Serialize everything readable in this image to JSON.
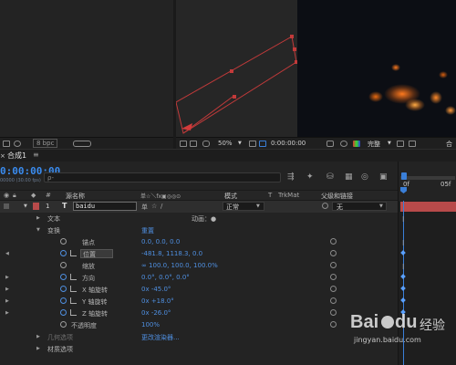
{
  "viewer": {
    "zoom": "50%",
    "timecode": "0:00:00:00",
    "resolution": "完整"
  },
  "project": {
    "bpc": "8 bpc"
  },
  "timeline": {
    "comp_tab": "合成1",
    "timecode": "0:00:00:00",
    "fps": "00000 (30.00 fps)",
    "search_placeholder": "ρ-",
    "columns": {
      "index": "#",
      "layer_name": "源名称",
      "switches": "单☆＼fx▣◎◎⊙",
      "mode": "模式",
      "t": "T",
      "trkmat": "TrkMat",
      "parent": "父级和链接"
    },
    "ruler_labels": [
      "0f",
      "05f"
    ],
    "layer": {
      "index": "1",
      "type": "T",
      "name": "baidu",
      "mode": "正常",
      "parent": "无"
    },
    "rows": [
      {
        "kind": "group",
        "label": "文本",
        "value": "",
        "extra": "动画：●"
      },
      {
        "kind": "group",
        "label": "变换",
        "value": "重置",
        "extra": ""
      },
      {
        "kind": "prop",
        "label": "锚点",
        "value": "0.0, 0.0, 0.0",
        "graph": false
      },
      {
        "kind": "prop",
        "label": "位置",
        "value": "-481.8, 1118.3, 0.0",
        "graph": true
      },
      {
        "kind": "prop",
        "label": "缩放",
        "value": "∞ 100.0, 100.0, 100.0%",
        "graph": false
      },
      {
        "kind": "prop",
        "label": "方向",
        "value": "0.0°, 0.0°, 0.0°",
        "graph": true
      },
      {
        "kind": "prop",
        "label": "X 轴旋转",
        "value": "0x -45.0°",
        "graph": true
      },
      {
        "kind": "prop",
        "label": "Y 轴旋转",
        "value": "0x +18.0°",
        "graph": true
      },
      {
        "kind": "prop",
        "label": "Z 轴旋转",
        "value": "0x -26.0°",
        "graph": true
      },
      {
        "kind": "prop",
        "label": "不透明度",
        "value": "100%",
        "graph": false
      },
      {
        "kind": "group",
        "label": "几何选项",
        "value": "更改渲染器...",
        "extra": ""
      },
      {
        "kind": "group",
        "label": "材质选项",
        "value": "",
        "extra": ""
      }
    ]
  },
  "watermark": {
    "brand": "Bai",
    "brand2": "du",
    "suffix": "经验",
    "url": "jingyan.baidu.com"
  },
  "colors": {
    "accent_blue": "#4f8fe0",
    "selection_red": "#c83c3c",
    "layer_bar": "#b84a4a",
    "playhead": "#3a7fd8"
  }
}
